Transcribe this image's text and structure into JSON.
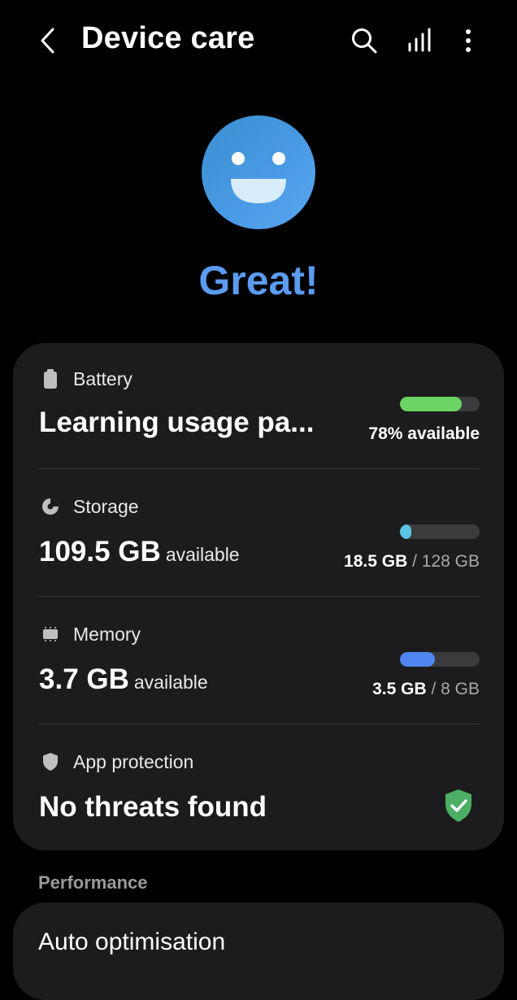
{
  "app": {
    "title": "Device care"
  },
  "status": {
    "text": "Great!"
  },
  "battery": {
    "label": "Battery",
    "headline": "Learning usage pa...",
    "level": 0.78,
    "meta": "78% available",
    "color": "#6cd465"
  },
  "storage": {
    "label": "Storage",
    "value": "109.5 GB",
    "suffix": "available",
    "used": "18.5 GB",
    "sep": "/",
    "total": "128 GB",
    "level": 0.145,
    "color": "#5bc4e6"
  },
  "memory": {
    "label": "Memory",
    "value": "3.7 GB",
    "suffix": "available",
    "used": "3.5 GB",
    "sep": "/",
    "total": "8 GB",
    "level": 0.44,
    "color": "#4f86f0"
  },
  "protection": {
    "label": "App protection",
    "headline": "No threats found",
    "color": "#4caf63"
  },
  "performance": {
    "section_label": "Performance",
    "item": "Auto optimisation"
  },
  "colors": {
    "accent": "#5b9bf0",
    "card": "#1c1c1e",
    "background": "#000000"
  }
}
